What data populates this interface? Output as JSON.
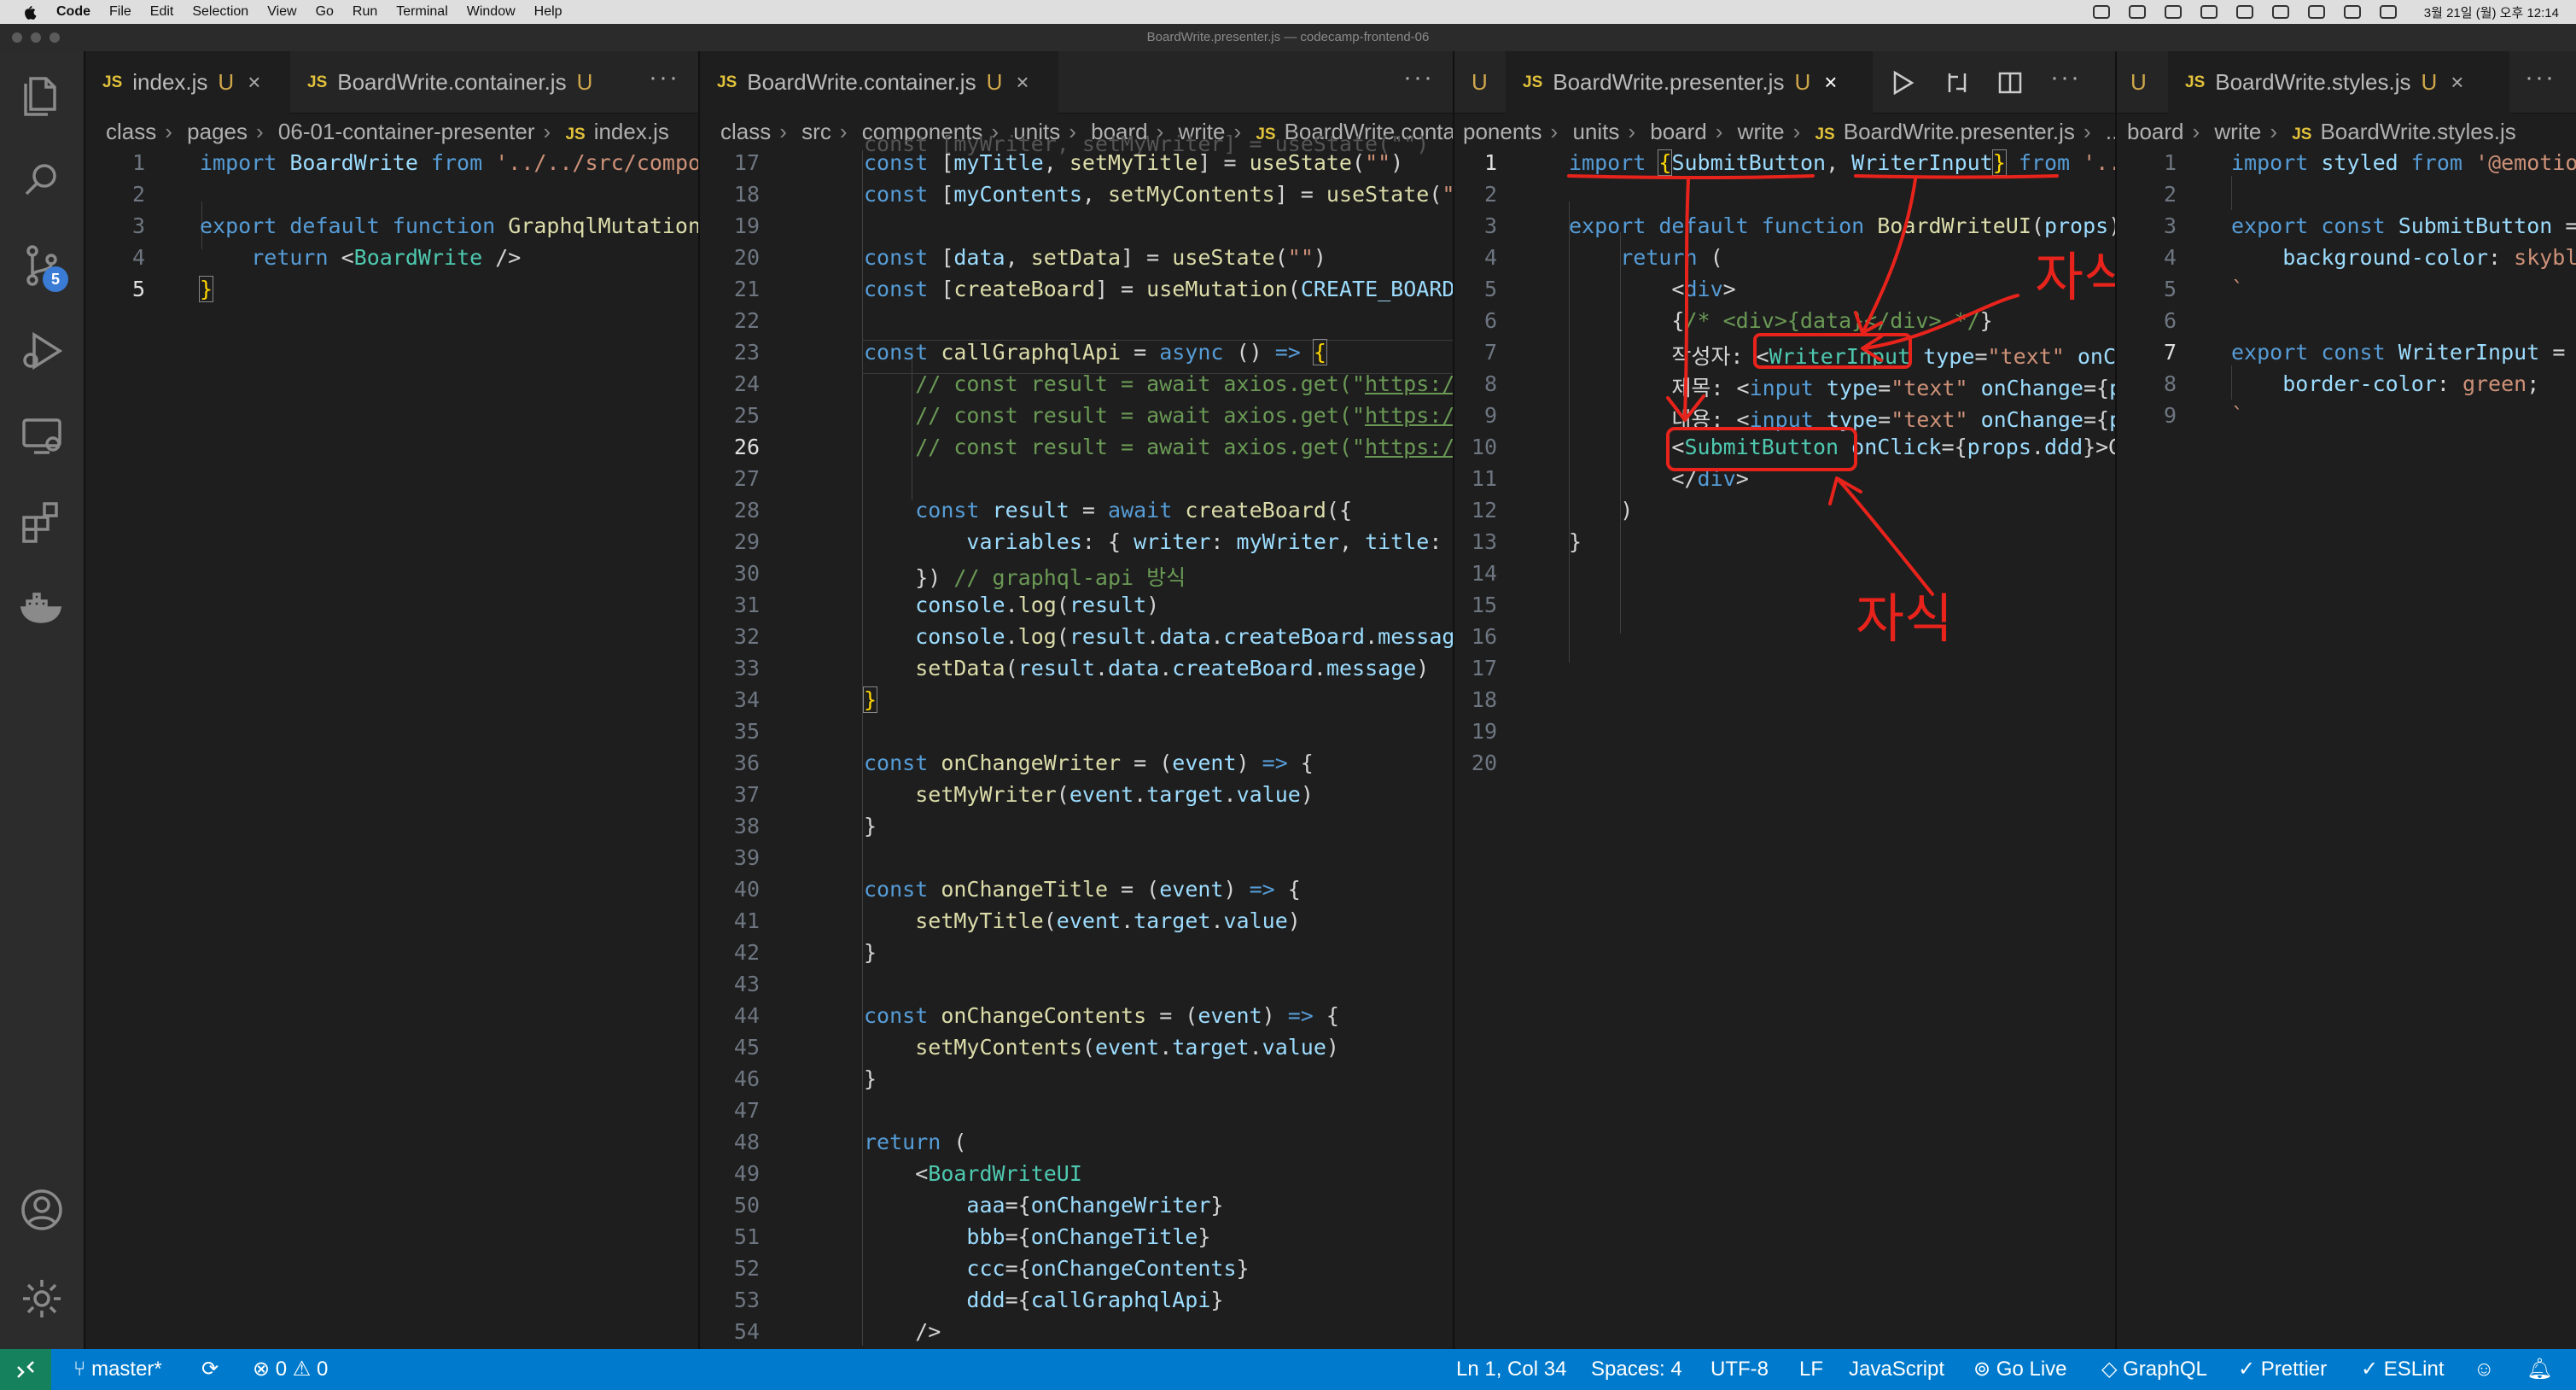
{
  "menubar": {
    "items": [
      "Code",
      "File",
      "Edit",
      "Selection",
      "View",
      "Go",
      "Run",
      "Terminal",
      "Window",
      "Help"
    ],
    "clock": "3월 21일 (월) 오후 12:14"
  },
  "window": {
    "title": "BoardWrite.presenter.js — codecamp-frontend-06"
  },
  "activity": {
    "scm_badge": "5"
  },
  "pane1": {
    "tab": {
      "icon": "JS",
      "label": "index.js",
      "u": "U",
      "close": "×"
    },
    "tab2": {
      "label": "BoardWrite.container.js",
      "u": "U"
    },
    "more": "···",
    "crumbs": [
      "class",
      "pages",
      "06-01-container-presenter",
      "index.js"
    ],
    "lines": [
      {
        "n": "1",
        "code": "import BoardWrite from '../../src/compor"
      },
      {
        "n": "2",
        "code": ""
      },
      {
        "n": "3",
        "code": "export default function GraphqlMutationP"
      },
      {
        "n": "4",
        "code": "    return <BoardWrite />"
      },
      {
        "n": "5",
        "code": "}"
      }
    ]
  },
  "pane2": {
    "tab": {
      "icon": "JS",
      "label": "BoardWrite.container.js",
      "u": "U",
      "close": "×"
    },
    "more": "···",
    "crumbs": [
      "class",
      "src",
      "components",
      "units",
      "board",
      "write",
      "BoardWrite.conta"
    ],
    "lines": [
      {
        "n": "17",
        "code": "const [myTitle, setMyTitle] = useState(\"\")"
      },
      {
        "n": "18",
        "code": "const [myContents, setMyContents] = useState(\"\""
      },
      {
        "n": "19",
        "code": ""
      },
      {
        "n": "20",
        "code": "const [data, setData] = useState(\"\")"
      },
      {
        "n": "21",
        "code": "const [createBoard] = useMutation(CREATE_BOARD)"
      },
      {
        "n": "22",
        "code": ""
      },
      {
        "n": "23",
        "code": "const callGraphqlApi = async () => {"
      },
      {
        "n": "24",
        "code": "    // const result = await axios.get(\"https://"
      },
      {
        "n": "25",
        "code": "    // const result = await axios.get(\"https://"
      },
      {
        "n": "26",
        "code": "    // const result = await axios.get(\"https://"
      },
      {
        "n": "27",
        "code": ""
      },
      {
        "n": "28",
        "code": "    const result = await createBoard({"
      },
      {
        "n": "29",
        "code": "        variables: { writer: myWriter, title: m"
      },
      {
        "n": "30",
        "code": "    }) // graphql-api 방식"
      },
      {
        "n": "31",
        "code": "    console.log(result)"
      },
      {
        "n": "32",
        "code": "    console.log(result.data.createBoard.message"
      },
      {
        "n": "33",
        "code": "    setData(result.data.createBoard.message)"
      },
      {
        "n": "34",
        "code": "}"
      },
      {
        "n": "35",
        "code": ""
      },
      {
        "n": "36",
        "code": "const onChangeWriter = (event) => {"
      },
      {
        "n": "37",
        "code": "    setMyWriter(event.target.value)"
      },
      {
        "n": "38",
        "code": "}"
      },
      {
        "n": "39",
        "code": ""
      },
      {
        "n": "40",
        "code": "const onChangeTitle = (event) => {"
      },
      {
        "n": "41",
        "code": "    setMyTitle(event.target.value)"
      },
      {
        "n": "42",
        "code": "}"
      },
      {
        "n": "43",
        "code": ""
      },
      {
        "n": "44",
        "code": "const onChangeContents = (event) => {"
      },
      {
        "n": "45",
        "code": "    setMyContents(event.target.value)"
      },
      {
        "n": "46",
        "code": "}"
      },
      {
        "n": "47",
        "code": ""
      },
      {
        "n": "48",
        "code": "return ("
      },
      {
        "n": "49",
        "code": "    <BoardWriteUI"
      },
      {
        "n": "50",
        "code": "        aaa={onChangeWriter}"
      },
      {
        "n": "51",
        "code": "        bbb={onChangeTitle}"
      },
      {
        "n": "52",
        "code": "        ccc={onChangeContents}"
      },
      {
        "n": "53",
        "code": "        ddd={callGraphqlApi}"
      },
      {
        "n": "54",
        "code": "    />"
      }
    ]
  },
  "pane3": {
    "tab_prev_u": "U",
    "tab": {
      "icon": "JS",
      "label": "BoardWrite.presenter.js",
      "u": "U",
      "close": "×"
    },
    "more": "···",
    "crumbs": [
      "ponents",
      "units",
      "board",
      "write",
      "BoardWrite.presenter.js",
      "..."
    ],
    "lines": [
      {
        "n": "1",
        "code": "import {SubmitButton, WriterInput} from '.."
      },
      {
        "n": "2",
        "code": ""
      },
      {
        "n": "3",
        "code": "export default function BoardWriteUI(props){"
      },
      {
        "n": "4",
        "code": "    return ("
      },
      {
        "n": "5",
        "code": "        <div>"
      },
      {
        "n": "6",
        "code": "        {/* <div>{data}</div> */}"
      },
      {
        "n": "7",
        "code": "        작성자: <WriterInput type=\"text\" onCha"
      },
      {
        "n": "8",
        "code": "        제목: <input type=\"text\" onChange={pr"
      },
      {
        "n": "9",
        "code": "        내용: <input type=\"text\" onChange={pr"
      },
      {
        "n": "10",
        "code": "        <SubmitButton onClick={props.ddd}>GR"
      },
      {
        "n": "11",
        "code": "        </div>"
      },
      {
        "n": "12",
        "code": "    )"
      },
      {
        "n": "13",
        "code": "}"
      },
      {
        "n": "14",
        "code": ""
      },
      {
        "n": "15",
        "code": ""
      },
      {
        "n": "16",
        "code": ""
      },
      {
        "n": "17",
        "code": ""
      },
      {
        "n": "18",
        "code": ""
      },
      {
        "n": "19",
        "code": ""
      },
      {
        "n": "20",
        "code": ""
      }
    ],
    "annotation": {
      "label1": "자식",
      "label2": "자식",
      "color": "#e8231c"
    }
  },
  "pane4": {
    "tab_prev_u": "U",
    "tab": {
      "icon": "JS",
      "label": "BoardWrite.styles.js",
      "u": "U",
      "close": "×"
    },
    "more": "···",
    "crumbs": [
      "board",
      "write",
      "BoardWrite.styles.js"
    ],
    "lines": [
      {
        "n": "1",
        "code": "import styled from '@emotion"
      },
      {
        "n": "2",
        "code": ""
      },
      {
        "n": "3",
        "code": "export const SubmitButton = "
      },
      {
        "n": "4",
        "code": "    background-color: skyblu"
      },
      {
        "n": "5",
        "code": "`"
      },
      {
        "n": "6",
        "code": ""
      },
      {
        "n": "7",
        "code": "export const WriterInput = s"
      },
      {
        "n": "8",
        "code": "    border-color: green;"
      },
      {
        "n": "9",
        "code": "`"
      }
    ]
  },
  "statusbar": {
    "branch": "master*",
    "problems": "⊗ 0 ⚠ 0",
    "position": "Ln 1, Col 34",
    "spaces": "Spaces: 4",
    "encoding": "UTF-8",
    "eol": "LF",
    "language": "JavaScript",
    "golive": "Go Live",
    "graphql": "GraphQL",
    "prettier": "Prettier",
    "eslint": "ESLint"
  }
}
